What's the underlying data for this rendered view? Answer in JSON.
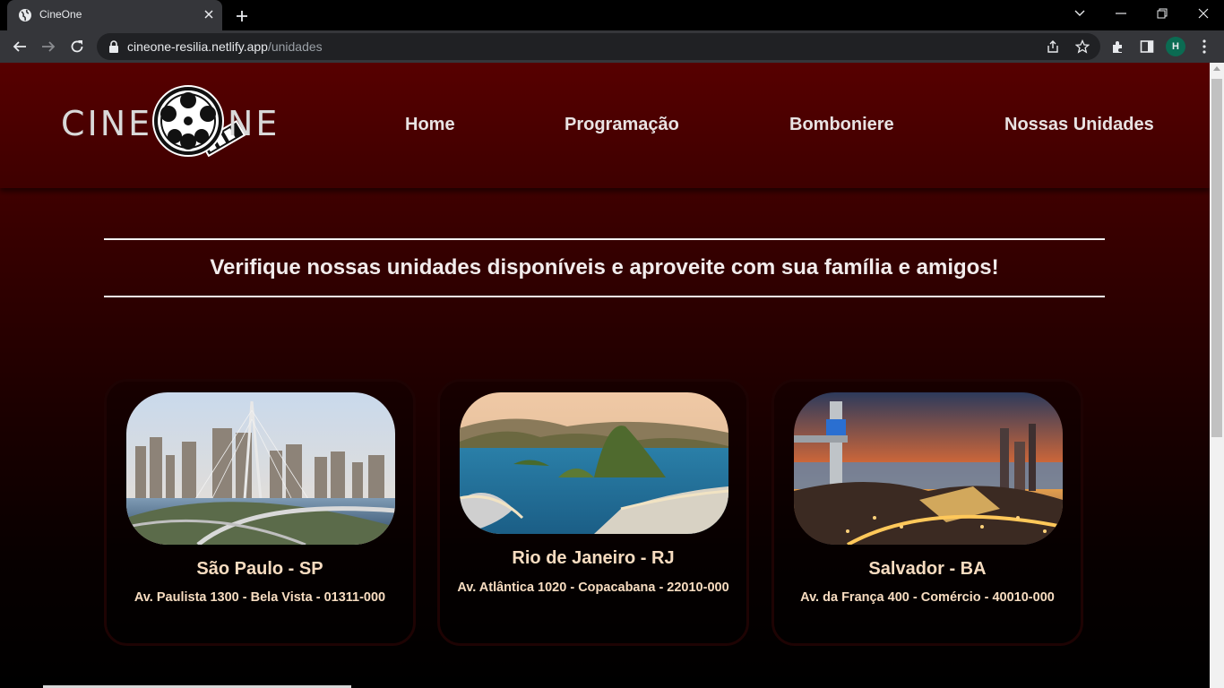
{
  "browser": {
    "tab_title": "CineOne",
    "url_host": "cineone-resilia.netlify.app",
    "url_path": "/unidades",
    "profile_initial": "H",
    "icons": [
      "globe-icon",
      "close-icon",
      "plus-icon",
      "chevron-down-icon",
      "minimize-icon",
      "restore-icon",
      "back-icon",
      "forward-icon",
      "reload-icon",
      "lock-icon",
      "share-icon",
      "star-icon",
      "extensions-icon",
      "side-panel-icon",
      "kebab-menu-icon"
    ]
  },
  "site": {
    "logo_left": "CINE",
    "logo_right": "NE",
    "nav": [
      {
        "label": "Home"
      },
      {
        "label": "Programação"
      },
      {
        "label": "Bomboniere"
      },
      {
        "label": "Nossas Unidades"
      }
    ],
    "headline": "Verifique nossas unidades disponíveis e aproveite com sua família e amigos!",
    "units": [
      {
        "city": "São Paulo - SP",
        "address": "Av. Paulista 1300 - Bela Vista - 01311-000"
      },
      {
        "city": "Rio de Janeiro - RJ",
        "address": "Av. Atlântica 1020 - Copacabana - 22010-000"
      },
      {
        "city": "Salvador - BA",
        "address": "Av. da França 400 - Comércio - 40010-000"
      }
    ]
  },
  "colors": {
    "header_red": "#570000",
    "text_light": "#e9e3e3",
    "card_text": "#f7dcc0",
    "profile_green": "#0b6b52"
  }
}
